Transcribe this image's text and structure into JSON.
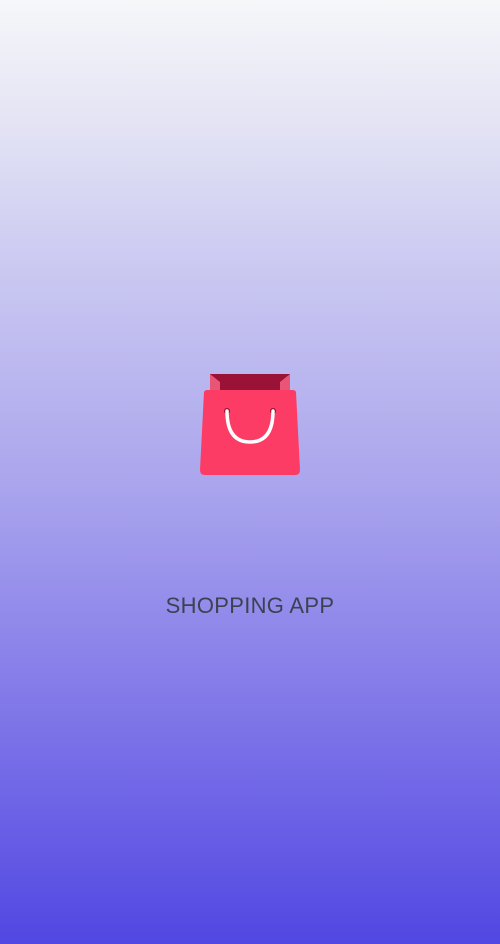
{
  "app": {
    "title": "SHOPPING APP",
    "icon": "shopping-bag-icon",
    "colors": {
      "gradient_top": "#f6f7f9",
      "gradient_bottom": "#5147e2",
      "bag_primary": "#fd3c66",
      "bag_dark": "#9a1336",
      "title_text": "#3f4153"
    }
  }
}
